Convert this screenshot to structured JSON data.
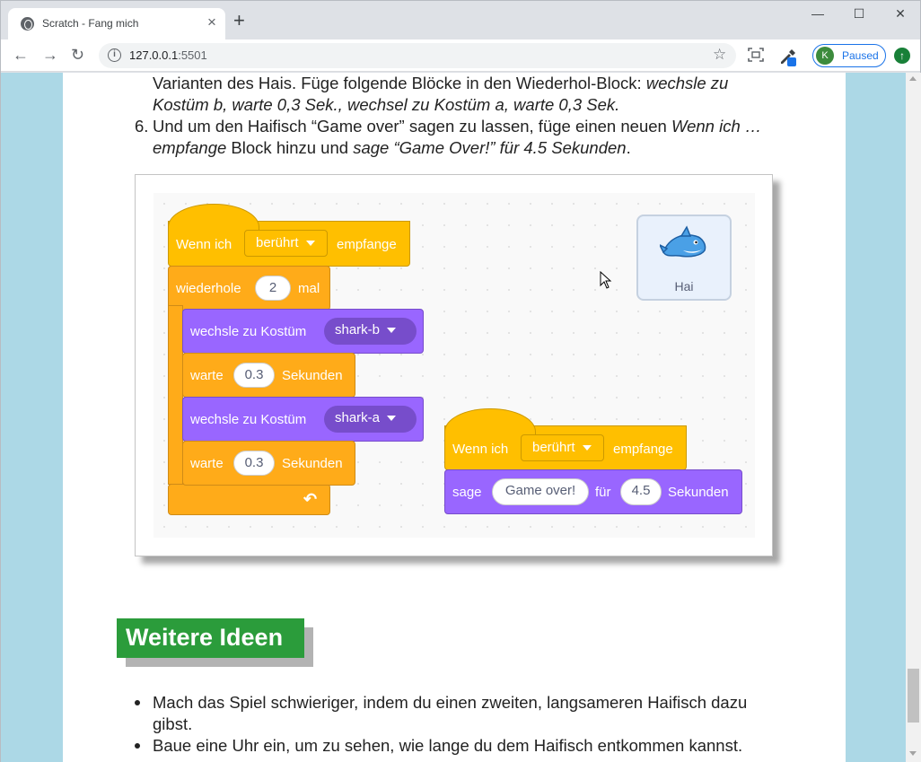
{
  "browser": {
    "tab_title": "Scratch - Fang mich",
    "tab_close": "×",
    "new_tab": "+",
    "url_host": "127.0.0.1",
    "url_port": ":5501",
    "profile_initial": "K",
    "profile_status": "Paused",
    "window_controls": {
      "minimize": "—",
      "maximize": "☐",
      "close": "✕"
    }
  },
  "content": {
    "para_line1_normal": "Varianten des Hais. Füge folgende Blöcke in den Wiederhol-Block: ",
    "para_line1_italic": "wechsle zu",
    "para_line2_italic": "Kostüm b, warte 0,3 Sek., wechsel zu Kostüm a, warte 0,3 Sek.",
    "step6_number": "6.",
    "step6_line1_normal": "Und um den Haifisch “Game over” sagen zu lassen, füge einen neuen ",
    "step6_line1_italic": "Wenn ich …",
    "step6_line2_italic_a": "empfange",
    "step6_line2_normal": " Block hinzu und ",
    "step6_line2_italic_b": "sage “Game Over!” für 4.5 Sekunden",
    "step6_line2_end": ".",
    "section_heading": "Weitere Ideen",
    "bullets": [
      {
        "line1": "Mach das Spiel schwieriger, indem du einen zweiten, langsameren Haifisch dazu",
        "line2": "gibst."
      },
      {
        "line1": "Baue eine Uhr ein, um zu sehen, wie lange du dem Haifisch entkommen kannst.",
        "line2": ""
      }
    ]
  },
  "scratch": {
    "script1": {
      "hat_when": "Wenn ich",
      "hat_dropdown": "berührt",
      "hat_receive": "empfange",
      "repeat_label": "wiederhole",
      "repeat_count": "2",
      "repeat_times": "mal",
      "costume_label": "wechsle zu Kostüm",
      "costume_b": "shark-b",
      "costume_a": "shark-a",
      "wait_label": "warte",
      "wait_value": "0.3",
      "wait_unit": "Sekunden",
      "repeat_arrow": "↶"
    },
    "script2": {
      "hat_when": "Wenn ich",
      "hat_dropdown": "berührt",
      "hat_receive": "empfange",
      "say_label": "sage",
      "say_text": "Game over!",
      "for_label": "für",
      "for_value": "4.5",
      "for_unit": "Sekunden"
    },
    "sprite_name": "Hai"
  },
  "colors": {
    "event": "#ffbf00",
    "control": "#ffab19",
    "looks": "#9966ff",
    "heading_bg": "#2b9c3b",
    "page_bg": "#acd8e6"
  }
}
